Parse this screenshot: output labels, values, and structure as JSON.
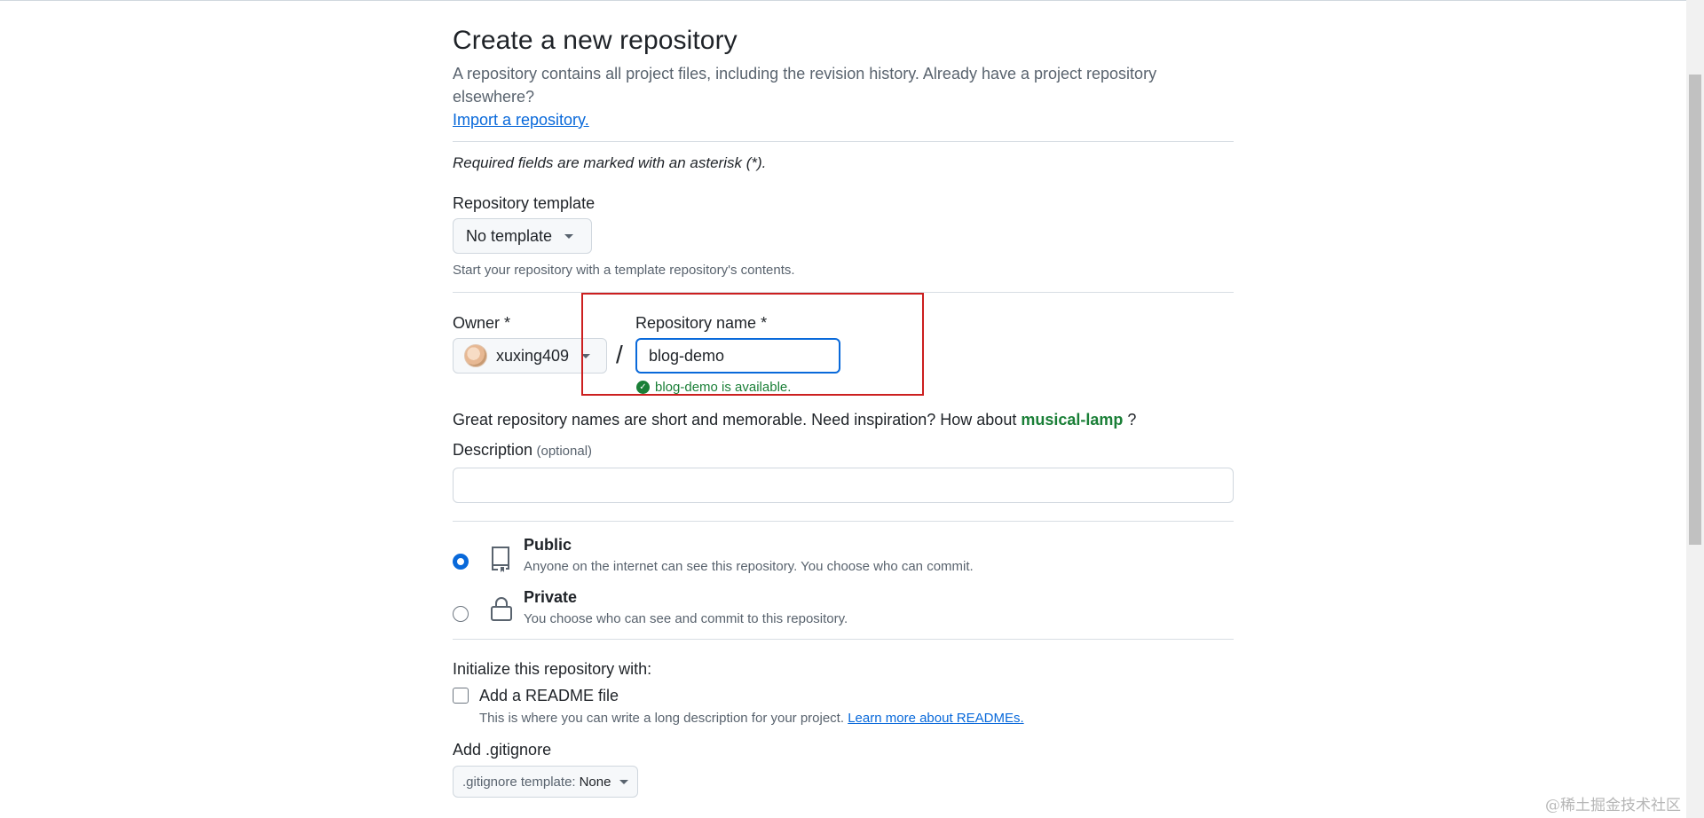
{
  "page": {
    "title": "Create a new repository",
    "intro": "A repository contains all project files, including the revision history. Already have a project repository elsewhere?",
    "import_link": "Import a repository.",
    "required_note": "Required fields are marked with an asterisk (*)."
  },
  "template": {
    "label": "Repository template",
    "button_label": "No template",
    "note": "Start your repository with a template repository's contents."
  },
  "owner": {
    "label": "Owner *",
    "value": "xuxing409"
  },
  "separator": "/",
  "repo_name": {
    "label": "Repository name *",
    "value": "blog-demo",
    "availability": "blog-demo is available."
  },
  "suggestion": {
    "text": "Great repository names are short and memorable. Need inspiration? How about",
    "name": "musical-lamp",
    "suffix": "?"
  },
  "description": {
    "label": "Description",
    "optional": "(optional)",
    "value": ""
  },
  "visibility": {
    "options": [
      {
        "label": "Public",
        "desc": "Anyone on the internet can see this repository. You choose who can commit.",
        "selected": true
      },
      {
        "label": "Private",
        "desc": "You choose who can see and commit to this repository.",
        "selected": false
      }
    ]
  },
  "init": {
    "heading": "Initialize this repository with:",
    "readme_label": "Add a README file",
    "readme_desc": "This is where you can write a long description for your project.",
    "readme_link": "Learn more about READMEs.",
    "readme_checked": false
  },
  "gitignore": {
    "heading": "Add .gitignore",
    "button_prefix": ".gitignore template:",
    "button_value": "None"
  },
  "watermark": "@稀土掘金技术社区",
  "colors": {
    "accent": "#0969da",
    "success": "#1a7f37",
    "annotation": "#cc1f1f"
  },
  "icons": {
    "repo": "repo-icon",
    "lock": "lock-icon",
    "check": "check-circle-icon",
    "caret": "triangle-down-icon"
  }
}
